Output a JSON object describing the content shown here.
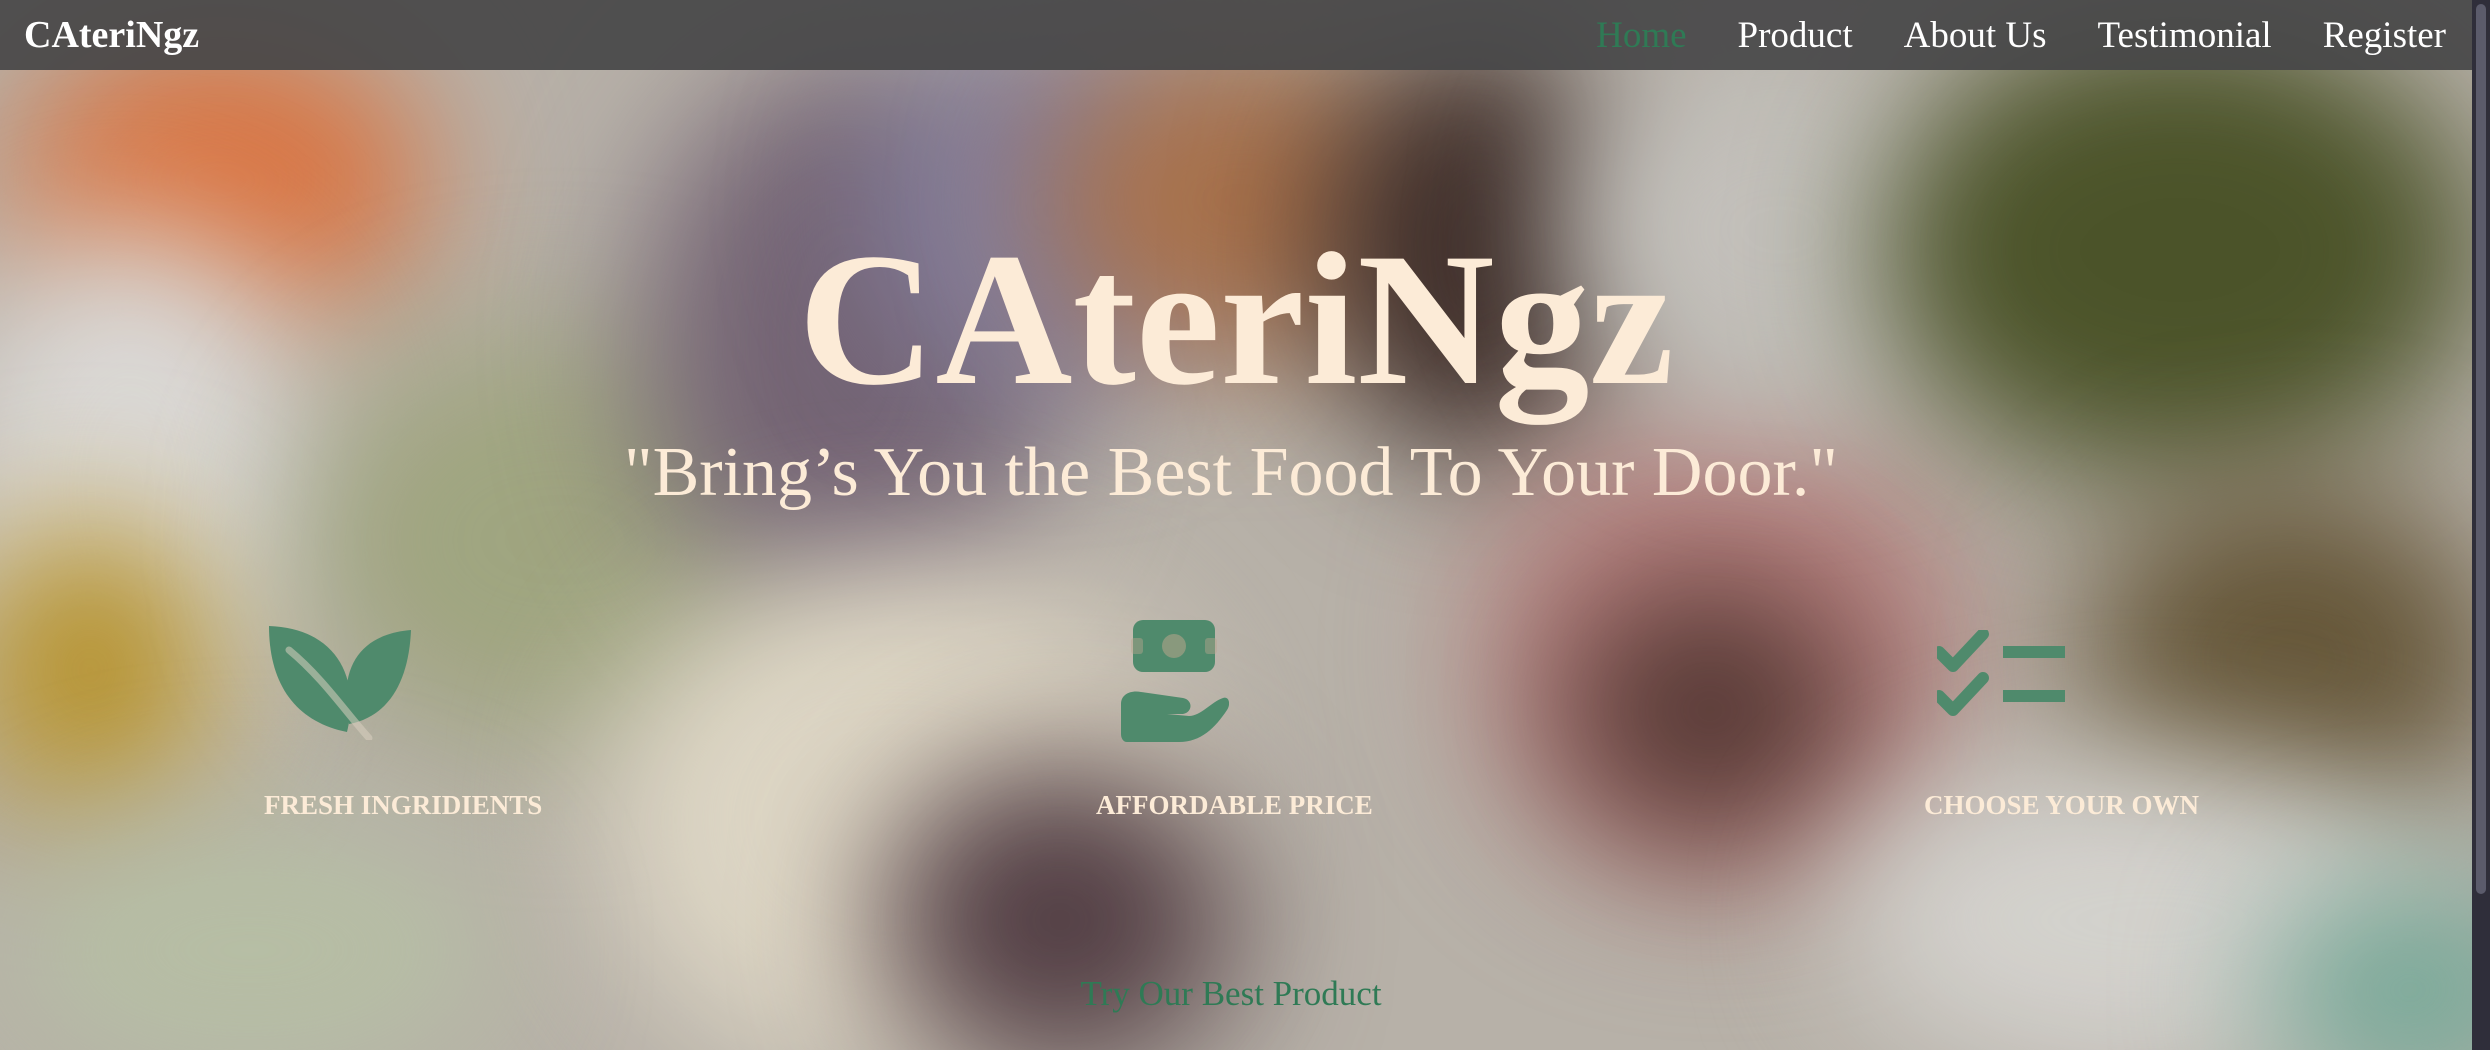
{
  "colors": {
    "nav_background": "#464648",
    "nav_text": "#ffffff",
    "nav_active": "#2f7a55",
    "hero_text": "#fcebd7",
    "icon_green": "#4f8a6c",
    "cta_text": "#2f7a55"
  },
  "navbar": {
    "brand": "CAteriNgz",
    "links": [
      {
        "label": "Home",
        "active": true
      },
      {
        "label": "Product",
        "active": false
      },
      {
        "label": "About Us",
        "active": false
      },
      {
        "label": "Testimonial",
        "active": false
      },
      {
        "label": "Register",
        "active": false
      }
    ]
  },
  "hero": {
    "title": "CAteriNgz",
    "subtitle": "\"Bring’s You the Best Food To Your Door.\""
  },
  "features": [
    {
      "icon": "leaf-icon",
      "title": "FRESH INGRIDIENTS"
    },
    {
      "icon": "hand-holding-money-icon",
      "title": "AFFORDABLE PRICE"
    },
    {
      "icon": "checklist-icon",
      "title": "CHOOSE YOUR OWN"
    }
  ],
  "cta": {
    "label": "Try Our Best Product"
  }
}
